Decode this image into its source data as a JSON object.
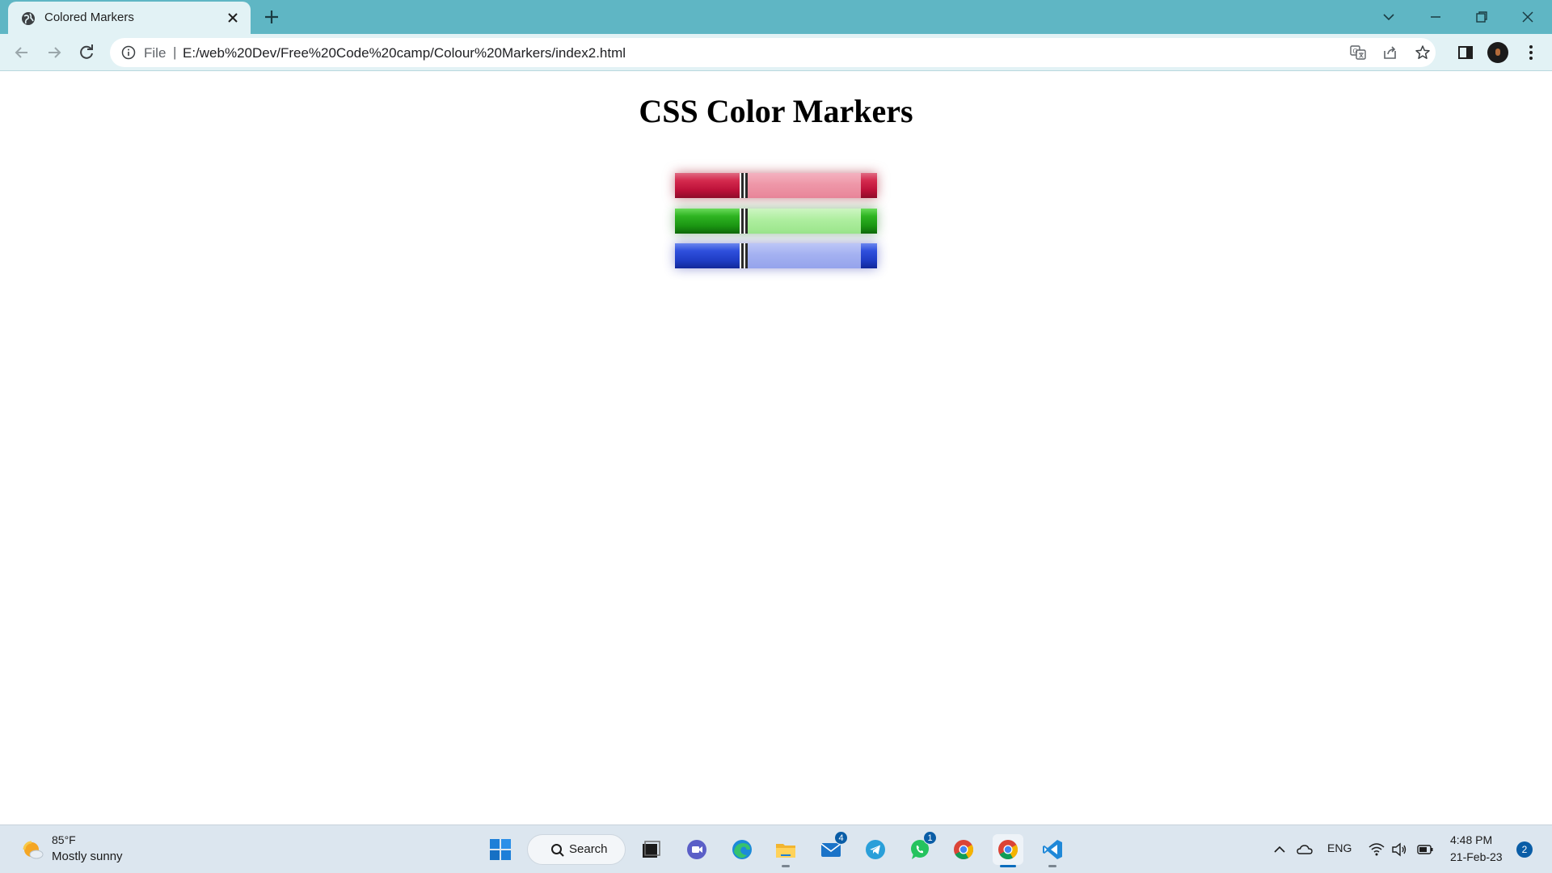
{
  "browser": {
    "tab_title": "Colored Markers",
    "url_scheme": "File",
    "url_separator": "|",
    "url": "E:/web%20Dev/Free%20Code%20camp/Colour%20Markers/index2.html"
  },
  "page": {
    "title": "CSS Color Markers",
    "markers": [
      {
        "name": "red",
        "color": "#c8143c"
      },
      {
        "name": "green",
        "color": "#22a418"
      },
      {
        "name": "blue",
        "color": "#2444cf"
      }
    ]
  },
  "taskbar": {
    "weather_temp": "85°F",
    "weather_desc": "Mostly sunny",
    "search_label": "Search",
    "mail_badge": "4",
    "whatsapp_badge": "1",
    "language": "ENG",
    "time": "4:48 PM",
    "date": "21-Feb-23",
    "notification_count": "2",
    "apps": [
      "start-icon",
      "search",
      "task-view-icon",
      "meet-icon",
      "edge-icon",
      "file-explorer-icon",
      "mail-icon",
      "telegram-icon",
      "whatsapp-icon",
      "chrome-icon",
      "chrome-icon",
      "vscode-icon"
    ]
  }
}
